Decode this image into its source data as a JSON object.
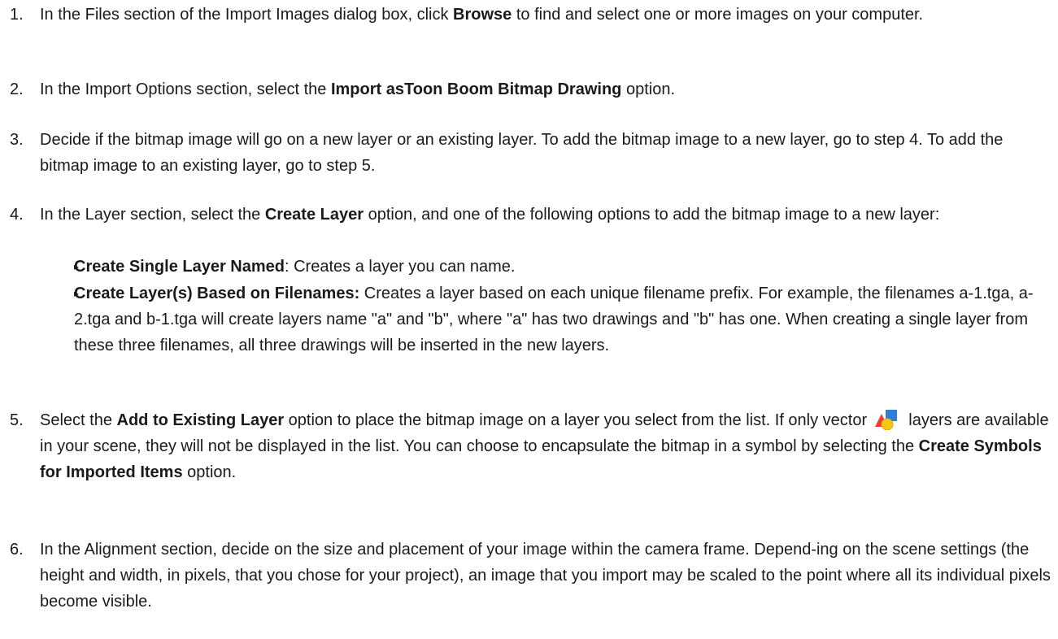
{
  "steps": [
    {
      "number": "1.",
      "pre": "In the Files section of the Import Images dialog box, click ",
      "bold": "Browse",
      "post": " to find and select one or more images on your computer."
    },
    {
      "number": "2.",
      "pre": "In the Import Options section, select the ",
      "bold": "Import asToon Boom Bitmap Drawing",
      "post": " option."
    },
    {
      "number": "3.",
      "text": "Decide if the bitmap image will go on a new layer or an existing layer. To add the bitmap image to a new layer, go to step 4. To add the bitmap image to an existing layer, go to step 5."
    },
    {
      "number": "4.",
      "pre": "In the Layer section, select the ",
      "bold": "Create Layer",
      "post": " option, and one of the following options to add the bitmap image to a new layer:",
      "bullets": [
        {
          "bold": "Create Single Layer Named",
          "text": ": Creates a layer you can name."
        },
        {
          "bold": "Create Layer(s) Based on Filenames:",
          "text": " Creates a layer based on each unique filename prefix. For example, the filenames a-1.tga, a-2.tga and b-1.tga will create layers name \"a\" and \"b\", where \"a\" has two drawings and \"b\" has one. When creating a single layer from these three filenames, all three drawings will be inserted in the new layers."
        }
      ]
    },
    {
      "number": "5.",
      "pre": "Select the ",
      "bold": "Add to Existing Layer",
      "mid": " option to place the bitmap image on a layer you select from the list. If only vector ",
      "mid2": " layers are available in your scene, they will not be displayed in the list. You can choose to encapsulate the bitmap in a symbol by selecting the ",
      "bold2": "Create Symbols for Imported Items",
      "post": " option.",
      "icon": "vector-layer-icon"
    },
    {
      "number": "6.",
      "text": "In the Alignment section, decide on the size and placement of your image within the camera frame. Depend-ing on the scene settings (the height and width, in pixels, that you chose for your project), an image that you import may be scaled to the point where all its individual pixels become visible."
    }
  ],
  "bullet_glyph": "▸",
  "colors": {
    "text": "#1a1a1a",
    "icon_red": "#e8402f",
    "icon_blue": "#2f7fd8",
    "icon_yellow": "#f5c518"
  }
}
